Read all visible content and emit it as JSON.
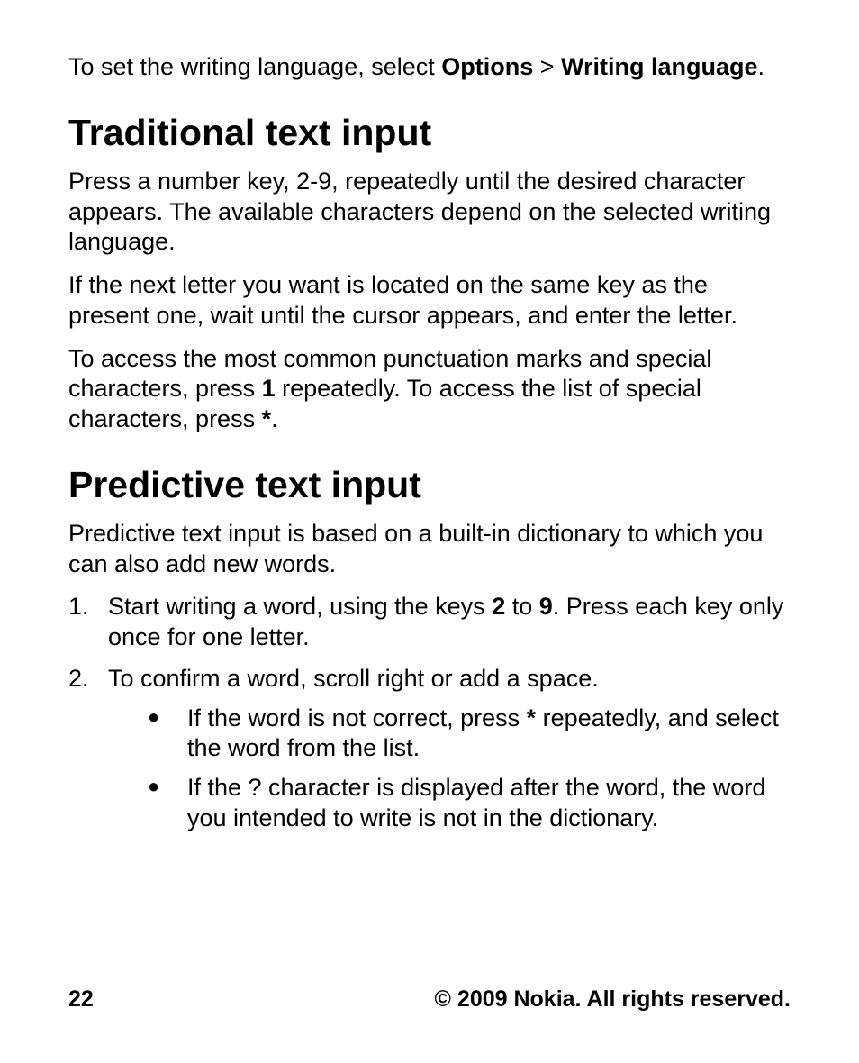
{
  "intro": {
    "prefix": "To set the writing language, select ",
    "bold1": "Options",
    "sep": " > ",
    "bold2": "Writing language",
    "period": "."
  },
  "section1": {
    "heading": "Traditional text input",
    "p1": "Press a number key, 2-9, repeatedly until the desired character appears. The available characters depend on the selected writing language.",
    "p2": "If the next letter you want is located on the same key as the present one, wait until the cursor appears, and enter the letter.",
    "p3_a": "To access the most common punctuation marks and special characters, press ",
    "p3_b1": "1",
    "p3_c": " repeatedly. To access the list of special characters, press ",
    "p3_b2": "*",
    "p3_d": "."
  },
  "section2": {
    "heading": "Predictive text input",
    "p1": "Predictive text input is based on a built-in dictionary to which you can also add new words.",
    "li1_num": "1.",
    "li1_a": "Start writing a word, using the keys ",
    "li1_b1": "2",
    "li1_mid": " to ",
    "li1_b2": "9",
    "li1_c": ". Press each key only once for one letter.",
    "li2_num": "2.",
    "li2_text": "To confirm a word, scroll right or add a space.",
    "sub1_a": "If the word is not correct, press ",
    "sub1_b": "*",
    "sub1_c": " repeatedly, and select the word from the list.",
    "sub2": "If the ? character is displayed after the word, the word you intended to write is not in the dictionary."
  },
  "footer": {
    "page": "22",
    "copyright": "© 2009 Nokia. All rights reserved."
  }
}
